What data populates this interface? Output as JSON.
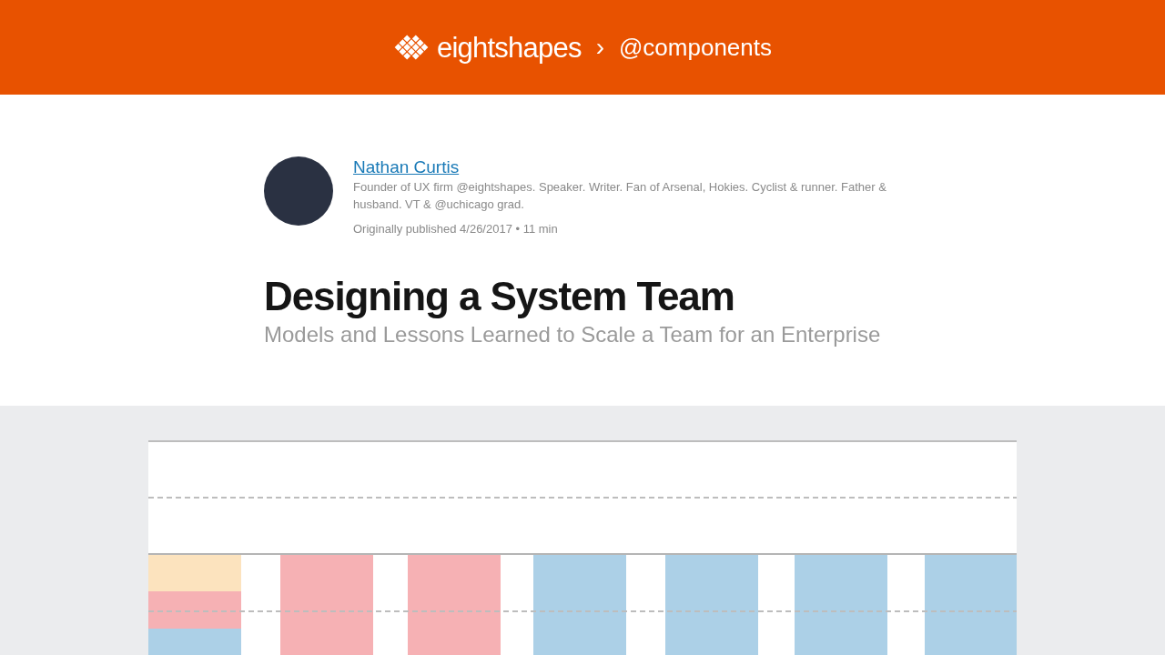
{
  "header": {
    "brand": "eightshapes",
    "separator": "›",
    "section": "@components"
  },
  "author": {
    "name": "Nathan Curtis",
    "bio": "Founder of UX firm @eightshapes. Speaker. Writer. Fan of Arsenal, Hokies. Cyclist & runner. Father & husband. VT & @uchicago grad.",
    "meta": "Originally published 4/26/2017 • 11 min"
  },
  "article": {
    "title": "Designing a System Team",
    "subtitle": "Models and Lessons Learned to Scale a Team for an Enterprise"
  }
}
